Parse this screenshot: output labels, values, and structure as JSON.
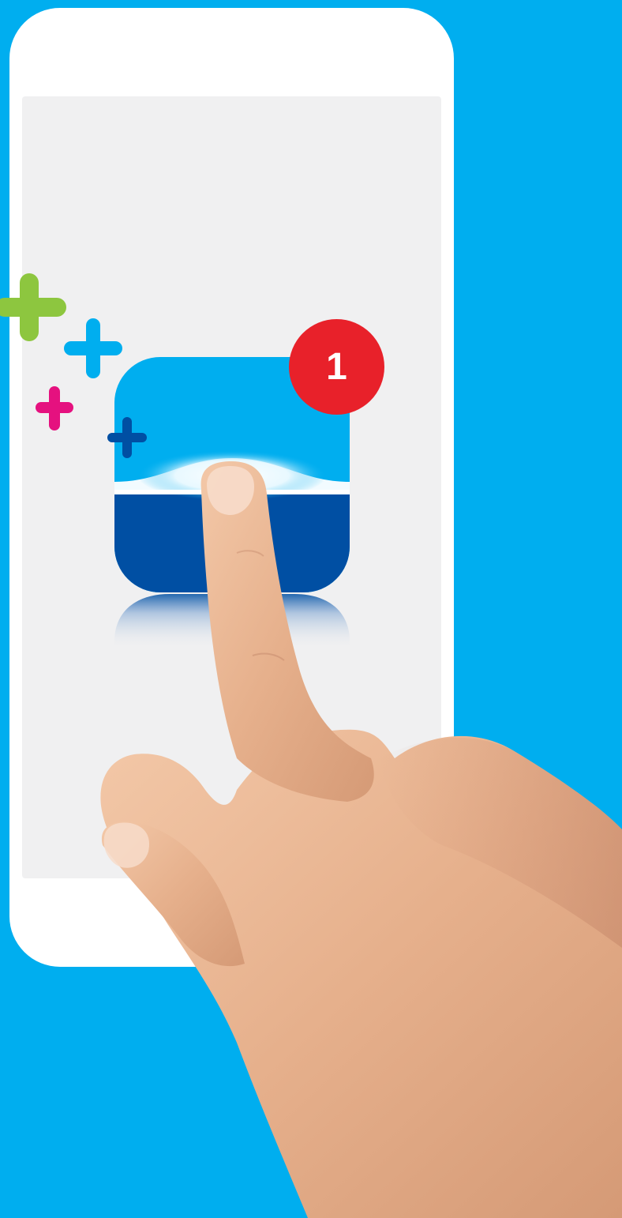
{
  "badge": {
    "count": "1"
  },
  "colors": {
    "background": "#00aeef",
    "phone_body": "#ffffff",
    "screen": "#f0f0f1",
    "icon_top": "#00aeef",
    "icon_bottom": "#004fa3",
    "badge": "#e8212a",
    "plus_green": "#8dc63f",
    "plus_cyan": "#00aeef",
    "plus_magenta": "#e5117f",
    "plus_navy": "#004fa3"
  },
  "icons": {
    "app_icon": "app-icon",
    "sparkles": [
      "plus-icon-green",
      "plus-icon-cyan",
      "plus-icon-magenta",
      "plus-icon-navy"
    ],
    "hand": "pointing-hand"
  }
}
